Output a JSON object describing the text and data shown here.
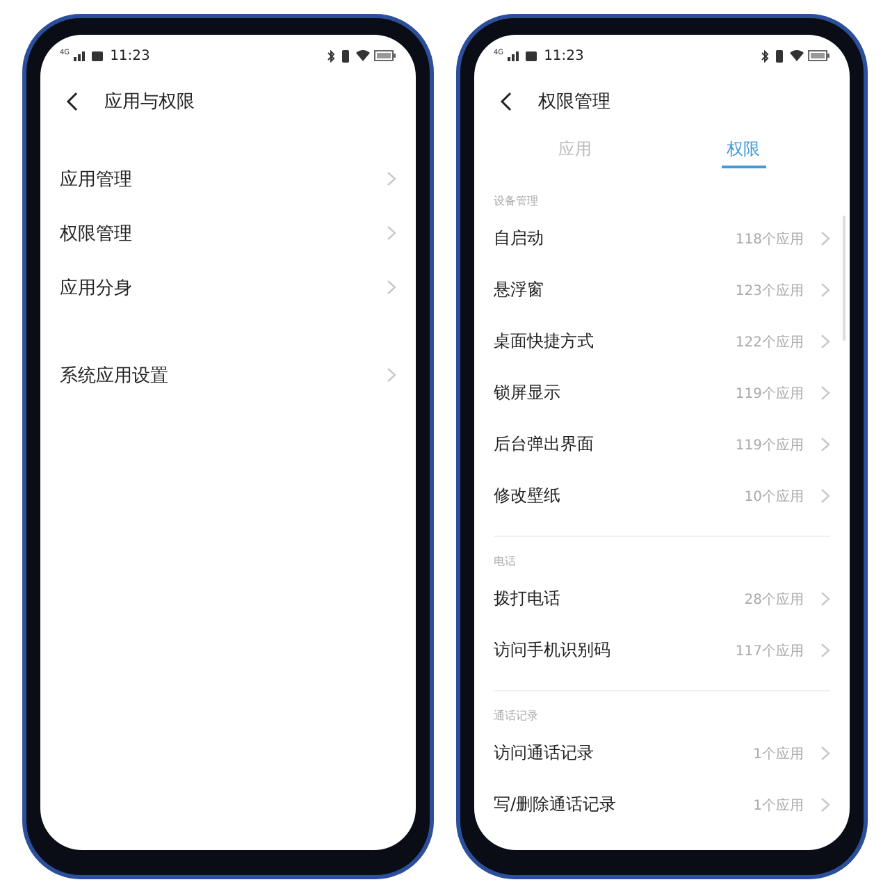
{
  "phones": [
    {
      "status": {
        "network": "4G",
        "time": "11:23"
      },
      "title": "应用与权限",
      "groups": [
        {
          "items": [
            {
              "label": "应用管理"
            },
            {
              "label": "权限管理"
            },
            {
              "label": "应用分身"
            }
          ]
        },
        {
          "items": [
            {
              "label": "系统应用设置"
            }
          ]
        }
      ]
    },
    {
      "status": {
        "network": "4G",
        "time": "11:23"
      },
      "title": "权限管理",
      "tabs": [
        {
          "label": "应用",
          "selected": false
        },
        {
          "label": "权限",
          "selected": true
        }
      ],
      "sections": [
        {
          "label": "设备管理",
          "rows": [
            {
              "label": "自启动",
              "count": "118个应用"
            },
            {
              "label": "悬浮窗",
              "count": "123个应用"
            },
            {
              "label": "桌面快捷方式",
              "count": "122个应用"
            },
            {
              "label": "锁屏显示",
              "count": "119个应用"
            },
            {
              "label": "后台弹出界面",
              "count": "119个应用"
            },
            {
              "label": "修改壁纸",
              "count": "10个应用"
            }
          ]
        },
        {
          "label": "电话",
          "rows": [
            {
              "label": "拨打电话",
              "count": "28个应用"
            },
            {
              "label": "访问手机识别码",
              "count": "117个应用"
            }
          ]
        },
        {
          "label": "通话记录",
          "rows": [
            {
              "label": "访问通话记录",
              "count": "1个应用"
            },
            {
              "label": "写/删除通话记录",
              "count": "1个应用"
            }
          ]
        }
      ]
    }
  ]
}
